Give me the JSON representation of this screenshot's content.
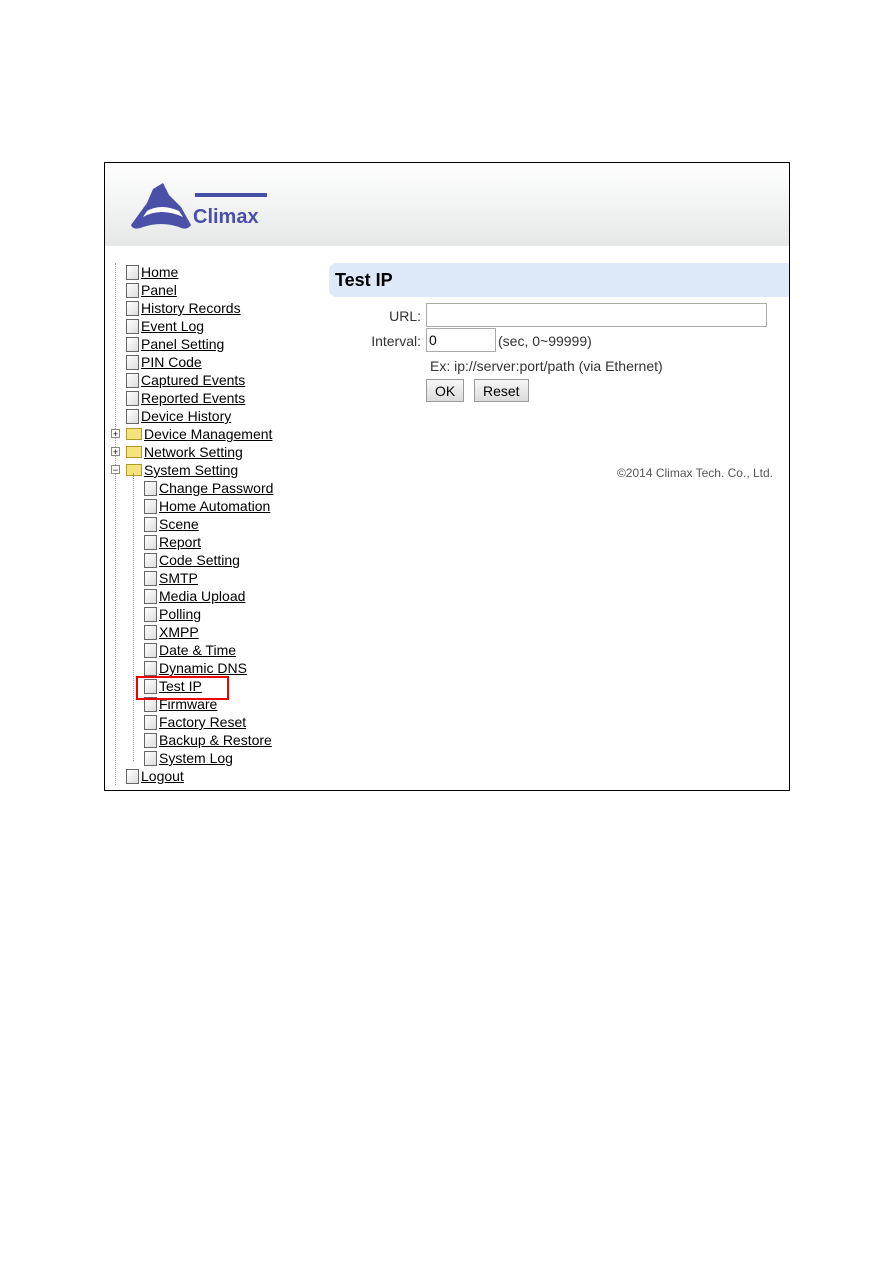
{
  "logo_text": "Climax",
  "nav": {
    "top": [
      {
        "label": "Home"
      },
      {
        "label": "Panel"
      },
      {
        "label": "History Records"
      },
      {
        "label": "Event Log"
      },
      {
        "label": "Panel Setting"
      },
      {
        "label": "PIN Code"
      },
      {
        "label": "Captured Events"
      },
      {
        "label": "Reported Events"
      },
      {
        "label": "Device History"
      }
    ],
    "folders": [
      {
        "label": "Device Management",
        "expanded": false
      },
      {
        "label": "Network Setting",
        "expanded": false
      },
      {
        "label": "System Setting",
        "expanded": true
      }
    ],
    "sub": [
      {
        "label": "Change Password"
      },
      {
        "label": "Home Automation"
      },
      {
        "label": "Scene"
      },
      {
        "label": "Report"
      },
      {
        "label": "Code Setting"
      },
      {
        "label": "SMTP"
      },
      {
        "label": "Media Upload"
      },
      {
        "label": "Polling"
      },
      {
        "label": "XMPP"
      },
      {
        "label": "Date & Time"
      },
      {
        "label": "Dynamic DNS"
      },
      {
        "label": "Test IP",
        "selected": true
      },
      {
        "label": "Firmware"
      },
      {
        "label": "Factory Reset"
      },
      {
        "label": "Backup & Restore"
      },
      {
        "label": "System Log"
      }
    ],
    "logout": "Logout"
  },
  "main": {
    "title": "Test IP",
    "url_label": "URL:",
    "url_value": "",
    "interval_label": "Interval:",
    "interval_value": "0",
    "interval_hint": "(sec, 0~99999)",
    "example": "Ex: ip://server:port/path (via Ethernet)",
    "ok": "OK",
    "reset": "Reset"
  },
  "footer": "©2014 Climax Tech. Co., Ltd.",
  "colors": {
    "logo": "#4a4fa8",
    "title_bg": "#dde8f8",
    "highlight": "#e00000"
  }
}
